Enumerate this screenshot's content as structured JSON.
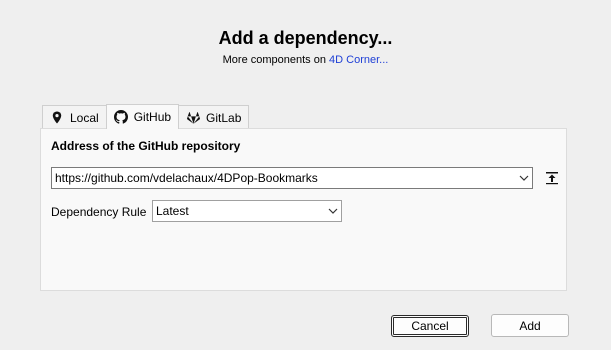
{
  "dialog": {
    "title": "Add a dependency...",
    "subtitle_prefix": "More components on ",
    "subtitle_link": "4D Corner..."
  },
  "tabs": [
    {
      "label": "Local",
      "icon": "location-pin-icon",
      "active": false
    },
    {
      "label": "GitHub",
      "icon": "github-icon",
      "active": true
    },
    {
      "label": "GitLab",
      "icon": "gitlab-icon",
      "active": false
    }
  ],
  "panel": {
    "heading": "Address of the GitHub repository",
    "url_value": "https://github.com/vdelachaux/4DPop-Bookmarks",
    "rule_label": "Dependency Rule",
    "rule_value": "Latest"
  },
  "buttons": {
    "cancel": "Cancel",
    "add": "Add"
  },
  "colors": {
    "link": "#1e3fd6",
    "background": "#efefef",
    "panel": "#f9f9f9"
  }
}
